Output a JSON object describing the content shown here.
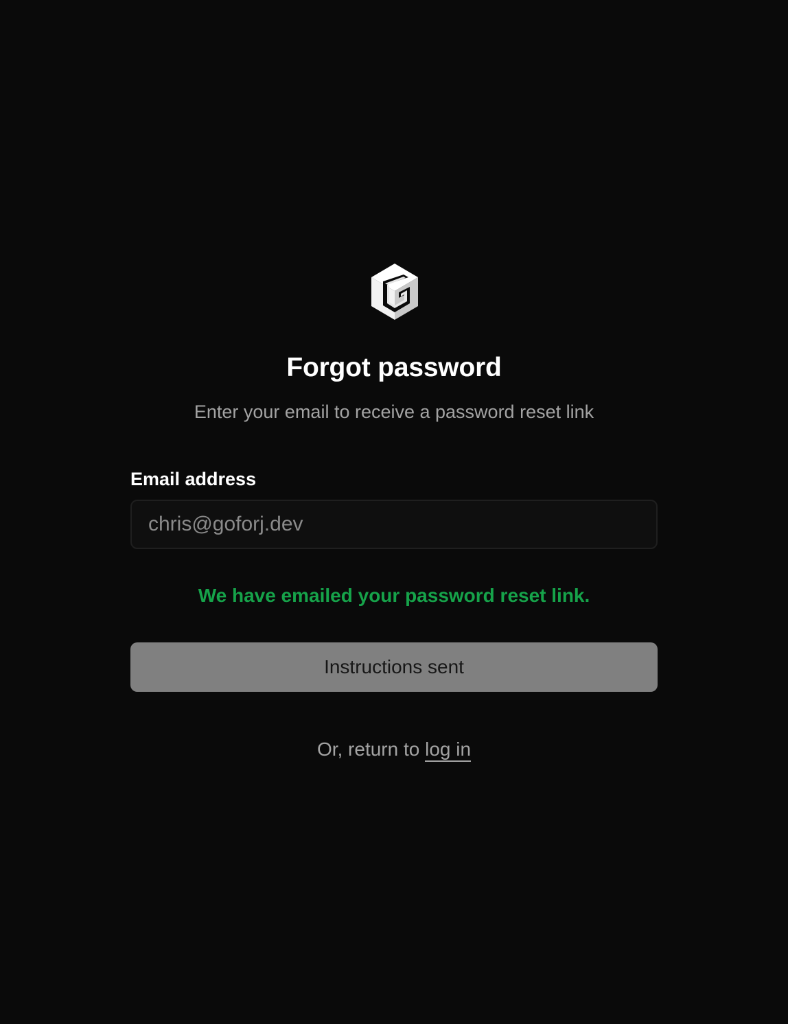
{
  "brand": {
    "logo_icon": "cube-g-logo-icon",
    "logo_letter": "G"
  },
  "heading": {
    "title": "Forgot password",
    "subtitle": "Enter your email to receive a password reset link"
  },
  "form": {
    "email_label": "Email address",
    "email_value": "chris@goforj.dev",
    "success_message": "We have emailed your password reset link.",
    "submit_label": "Instructions sent",
    "submit_disabled": true
  },
  "footer": {
    "prefix": "Or, return to",
    "link_label": "log in"
  },
  "colors": {
    "background": "#0a0a0a",
    "success": "#16a34a",
    "button_disabled": "#808080",
    "muted_text": "#a3a3a3"
  }
}
